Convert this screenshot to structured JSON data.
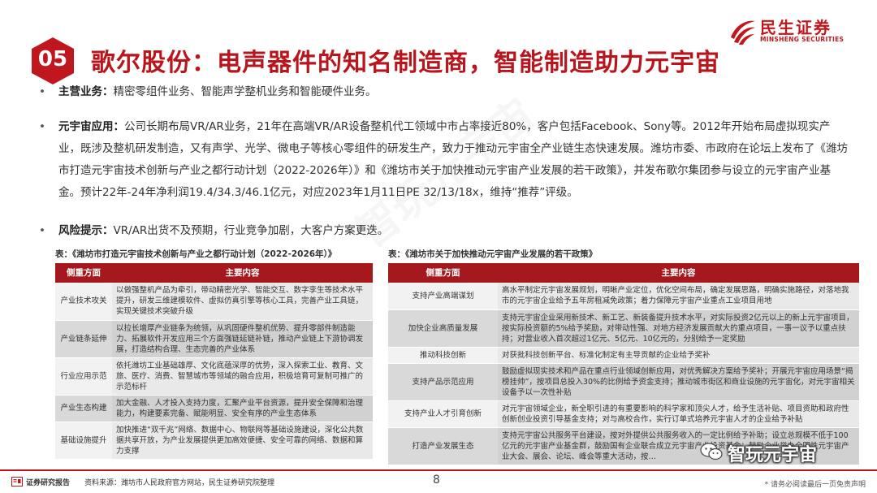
{
  "header": {
    "badge_number": "05",
    "title": "歌尔股份：电声器件的知名制造商，智能制造助力元宇宙"
  },
  "logo": {
    "name_cn": "民生证券",
    "name_en": "MINSHENG SECURITIES"
  },
  "bullets": [
    {
      "label": "主营业务：",
      "text": "精密零组件业务、智能声学整机业务和智能硬件业务。"
    },
    {
      "label": "元宇宙应用：",
      "text": "公司长期布局VR/AR业务，21年在高端VR/AR设备整机代工领域中市占率接近80%，客户包括Facebook、Sony等。2012年开始布局虚拟现实产业，既涉及整机研发制造，又有声学、光学、微电子等核心零组件的研发生产，致力于推动元宇宙全产业链生态快速发展。潍坊市委、市政府在论坛上发布了《潍坊市打造元宇宙技术创新与产业之都行动计划（2022-2026年）》和《潍坊市关于加快推动元宇宙产业发展的若干政策》，并发布歌尔集团参与设立的元宇宙产业基金。预计22年-24年净利润19.4/34.3/46.1亿元，对应2023年1月11日PE 32/13/18x，维持“推荐”评级。"
    },
    {
      "label": "风险提示：",
      "text": "VR/AR出货不及预期，行业竞争加剧，大客户方案更迭。"
    }
  ],
  "table1": {
    "caption": "表：《潍坊市打造元宇宙技术创新与产业之都行动计划（2022-2026年）》",
    "headers": [
      "侧重方面",
      "主要内容"
    ],
    "rows": [
      [
        "产业技术攻关",
        "以做强整机产品为牵引，带动精密光学、智能交互、数字孪生等技术水平提升，研发三维建模软件、虚拟仿真引擎等核心工具，完善产业工具链，实现关键技术突破升级"
      ],
      [
        "产业链条延伸",
        "以拉长增厚产业链条为统领，从巩固硬件整机优势、提升零部件制造能力、拓展软件开发应用三个方面强链延链补链，推动产业链上下游协调发展，打造结构合理、生态完善的产业体系"
      ],
      [
        "行业应用示范",
        "依托潍坊工业基础雄厚、文化底蕴深厚的优势，深入探索工业、教育、文旅、医疗、消费、智慧城市等领域的融合应用，积极培育可复制可推广的示范标杆"
      ],
      [
        "产业生态构建",
        "加大金融、人才投入支持力度，汇聚产业平台资源，提升安全保障和治理能力，构建要素完备、赋能明显、安全有序的产业生态体系"
      ],
      [
        "基础设施提升",
        "加快推进“双千兆”网络、数据中心、物联网等基础设施建设，深化公共数据共享开放，为产业发展提供更加高效便捷、安全可靠的网络、数据和算力支撑"
      ]
    ]
  },
  "table2": {
    "caption": "表：《潍坊市关于加快推动元宇宙产业发展的若干政策》",
    "headers": [
      "侧重方面",
      "主要内容"
    ],
    "rows": [
      [
        "支持产业高端谋划",
        "高水平制定元宇宙发展规划，明晰产业定位，优化空间布局，确定发展思路，明确实施路径，对落地我市的元宇宙企业给予五年房租减免政策；着力保障元宇宙产业重点工业项目用地"
      ],
      [
        "加快企业高质量发展",
        "支持元宇宙企业采用新技术、新工艺、新装备提升技术水平，对实际投资2亿元以上的新上元宇宙项目，按实际投资额的5%给予奖励，对带动性强、对地方经济发展贡献大的重点项目，一事一议予以重点扶持；对营业收入首次超过1亿元、5亿元、10亿元的，分别给予一定奖励"
      ],
      [
        "推动科技创新",
        "对获批科技创新平台、标准化制定有主导贡献的企业给予奖补"
      ],
      [
        "支持产品示范应用",
        "鼓励虚拟现实技术和产品在重点行业领域创新应用，对优秀解决方案给予奖补；开展元宇宙应用场景“揭榜挂帅”，按项目总投入30%的比例给予资金支持；推动城市街区和商业设施的元宇宙化，对元宇宙相关设备予以一次性补贴"
      ],
      [
        "支持产业人才引育创新",
        "对元宇宙领域企业，新全职引进的有重要影响的科学家和顶尖人才，给予生活补贴、项目资助和政府性创新创业投资引导基金支持；对与高校合作，实行订单式培养元宇宙人才的企业给予补贴"
      ],
      [
        "打造产业发展生态",
        "支持元宇宙公共服务平台建设，按对外提供公共服务收入的一定比例给予补助；设立总规模不低于100亿元的元宇宙产业基金群，鼓励国有企业联合成立元宇宙产业投资基金；鼓励企业举办全国性元宇宙产业大会、展会、论坛、峰会等重大活动，按…"
      ]
    ]
  },
  "footer": {
    "label": "证券研究报告",
    "source": "资料来源：潍坊市人民政府官方网站，民生证券研究院整理",
    "page": "8",
    "disclaimer": "* 请务必阅读最后一页免责声明"
  },
  "watermark": {
    "text": "智玩元宇宙"
  },
  "colors": {
    "brand_red": "#b8151c",
    "header_fill": "#a5191e"
  }
}
